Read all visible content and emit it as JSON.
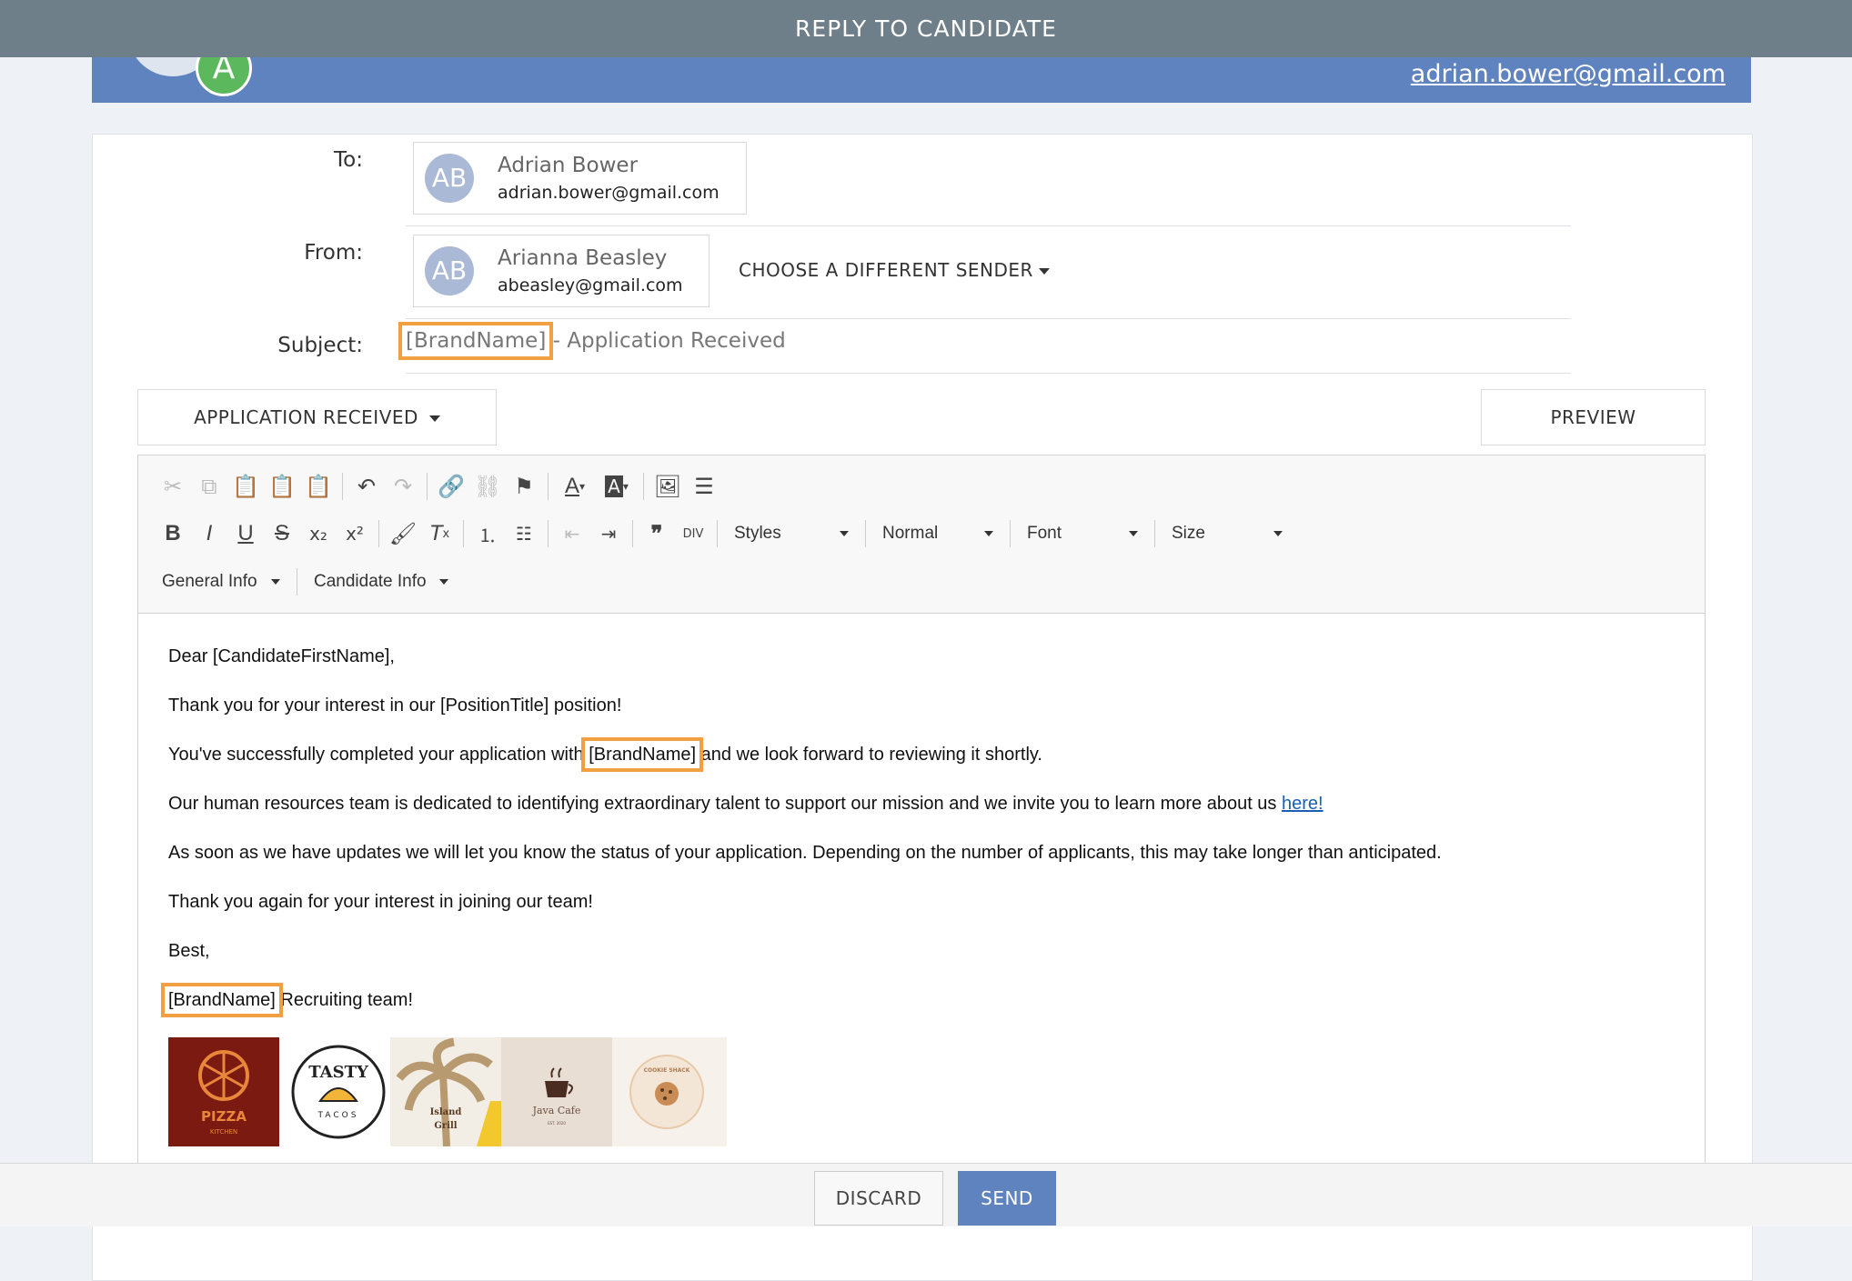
{
  "modal": {
    "title": "REPLY TO CANDIDATE"
  },
  "banner": {
    "avatar_letter": "A",
    "email": "adrian.bower@gmail.com"
  },
  "to": {
    "label": "To:",
    "initials": "AB",
    "name": "Adrian Bower",
    "email": "adrian.bower@gmail.com"
  },
  "from": {
    "label": "From:",
    "initials": "AB",
    "name": "Arianna Beasley",
    "email": "abeasley@gmail.com",
    "change_sender": "CHOOSE A DIFFERENT SENDER"
  },
  "subject": {
    "label": "Subject:",
    "brand_token": "[BrandName]",
    "rest": " - Application Received"
  },
  "template": {
    "selected": "APPLICATION RECEIVED"
  },
  "preview_label": "PREVIEW",
  "toolbar": {
    "styles": "Styles",
    "format": "Normal",
    "font": "Font",
    "size": "Size",
    "general_info": "General Info",
    "candidate_info": "Candidate Info"
  },
  "email_body": {
    "greeting": "Dear [CandidateFirstName],",
    "line1": "Thank you for your interest in our [PositionTitle] position!",
    "line2_pre": "You've successfully completed your application with ",
    "line2_token": "[BrandName]",
    "line2_post": " and we look forward to reviewing it shortly.",
    "line3_pre": "Our human resources team is dedicated to identifying extraordinary talent to support our mission and we invite you to learn more about us ",
    "line3_link": "here!",
    "line4": "As soon as we have updates we will let you know the status of your application. Depending on the number of applicants, this may take longer than anticipated.",
    "line5": "Thank you again for your interest in joining our team!",
    "signoff": "Best,",
    "sig_token": "[BrandName]",
    "sig_rest": " Recruiting team!"
  },
  "logos": [
    {
      "name": "pizza-kitchen",
      "text": "PIZZA",
      "sub": "KITCHEN",
      "bg": "#7a1a10"
    },
    {
      "name": "tasty-tacos",
      "text": "TASTY",
      "sub": "TACOS",
      "bg": "#ffffff"
    },
    {
      "name": "island-grill",
      "text": "Island",
      "sub": "Grill",
      "bg": "#f2eee6"
    },
    {
      "name": "java-cafe",
      "text": "Java Cafe",
      "sub": "EST. 2020",
      "bg": "#e8ded4"
    },
    {
      "name": "cookie-shack",
      "text": "COOKIE SHACK",
      "sub": "",
      "bg": "#f6f1ea"
    }
  ],
  "footer": {
    "discard": "DISCARD",
    "send": "SEND"
  },
  "colors": {
    "topbar": "#6f7f89",
    "banner": "#5f83bf",
    "highlight": "#f0a040",
    "send": "#5f83bf"
  }
}
